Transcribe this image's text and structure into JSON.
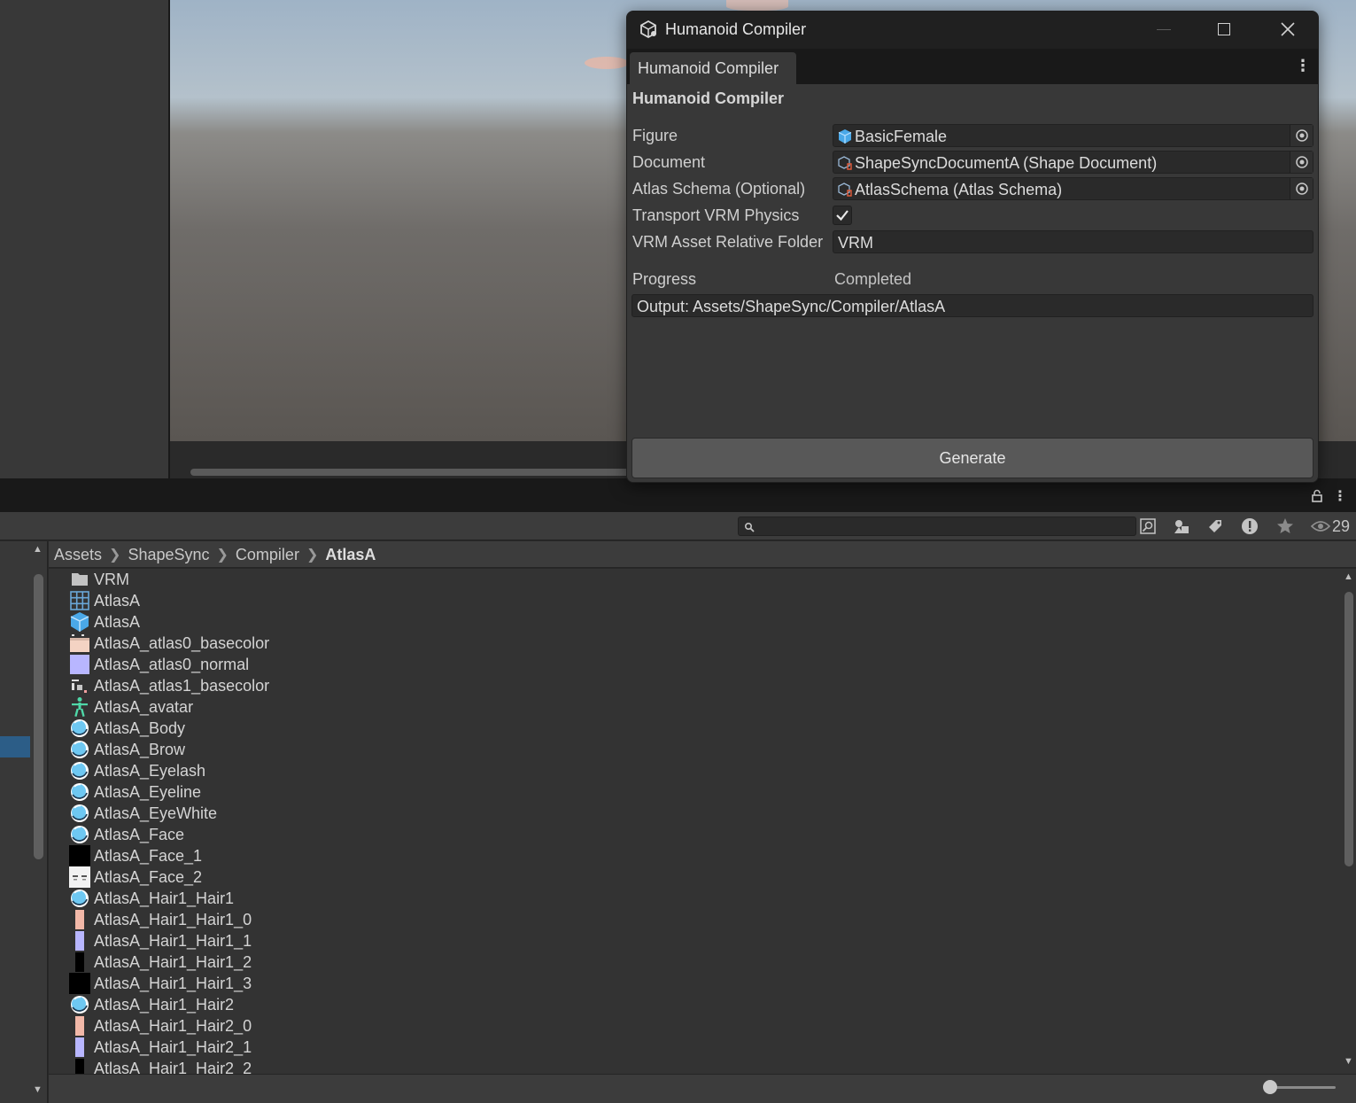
{
  "dialog": {
    "title": "Humanoid Compiler",
    "tab_label": "Humanoid Compiler",
    "header": "Humanoid Compiler",
    "fields": [
      {
        "label": "Figure",
        "value": "BasicFemale",
        "icon": "prefab-cube-icon"
      },
      {
        "label": "Document",
        "value": "ShapeSyncDocumentA (Shape Document)",
        "icon": "scriptable-object-icon"
      },
      {
        "label": "Atlas Schema (Optional)",
        "value": "AtlasSchema (Atlas Schema)",
        "icon": "scriptable-object-icon"
      }
    ],
    "transport_label": "Transport VRM Physics",
    "transport_checked": true,
    "folder_label": "VRM Asset Relative Folder",
    "folder_value": "VRM",
    "progress_label": "Progress",
    "progress_value": "Completed",
    "output_text": "Output: Assets/ShapeSync/Compiler/AtlasA",
    "generate_label": "Generate"
  },
  "project": {
    "hidden_count": "29",
    "breadcrumb": [
      "Assets",
      "ShapeSync",
      "Compiler",
      "AtlasA"
    ],
    "files": [
      {
        "name": "VRM",
        "icon": "folder"
      },
      {
        "name": "AtlasA",
        "icon": "grid"
      },
      {
        "name": "AtlasA",
        "icon": "prefab"
      },
      {
        "name": "AtlasA_atlas0_basecolor",
        "icon": "texture-skin"
      },
      {
        "name": "AtlasA_atlas0_normal",
        "icon": "texture-normal"
      },
      {
        "name": "AtlasA_atlas1_basecolor",
        "icon": "texture-small"
      },
      {
        "name": "AtlasA_avatar",
        "icon": "avatar"
      },
      {
        "name": "AtlasA_Body",
        "icon": "material"
      },
      {
        "name": "AtlasA_Brow",
        "icon": "material"
      },
      {
        "name": "AtlasA_Eyelash",
        "icon": "material"
      },
      {
        "name": "AtlasA_Eyeline",
        "icon": "material"
      },
      {
        "name": "AtlasA_EyeWhite",
        "icon": "material"
      },
      {
        "name": "AtlasA_Face",
        "icon": "material"
      },
      {
        "name": "AtlasA_Face_1",
        "icon": "texture-black"
      },
      {
        "name": "AtlasA_Face_2",
        "icon": "texture-face"
      },
      {
        "name": "AtlasA_Hair1_Hair1",
        "icon": "material"
      },
      {
        "name": "AtlasA_Hair1_Hair1_0",
        "icon": "texture-skin-narrow"
      },
      {
        "name": "AtlasA_Hair1_Hair1_1",
        "icon": "texture-normal-narrow"
      },
      {
        "name": "AtlasA_Hair1_Hair1_2",
        "icon": "texture-black-narrow"
      },
      {
        "name": "AtlasA_Hair1_Hair1_3",
        "icon": "texture-black"
      },
      {
        "name": "AtlasA_Hair1_Hair2",
        "icon": "material"
      },
      {
        "name": "AtlasA_Hair1_Hair2_0",
        "icon": "texture-skin-narrow"
      },
      {
        "name": "AtlasA_Hair1_Hair2_1",
        "icon": "texture-normal-narrow"
      },
      {
        "name": "AtlasA_Hair1_Hair2_2",
        "icon": "texture-black-narrow"
      }
    ]
  },
  "colors": {
    "selection": "#2c5d87",
    "material_icon": "#6ec8f2",
    "avatar_icon": "#4fd8a8"
  }
}
